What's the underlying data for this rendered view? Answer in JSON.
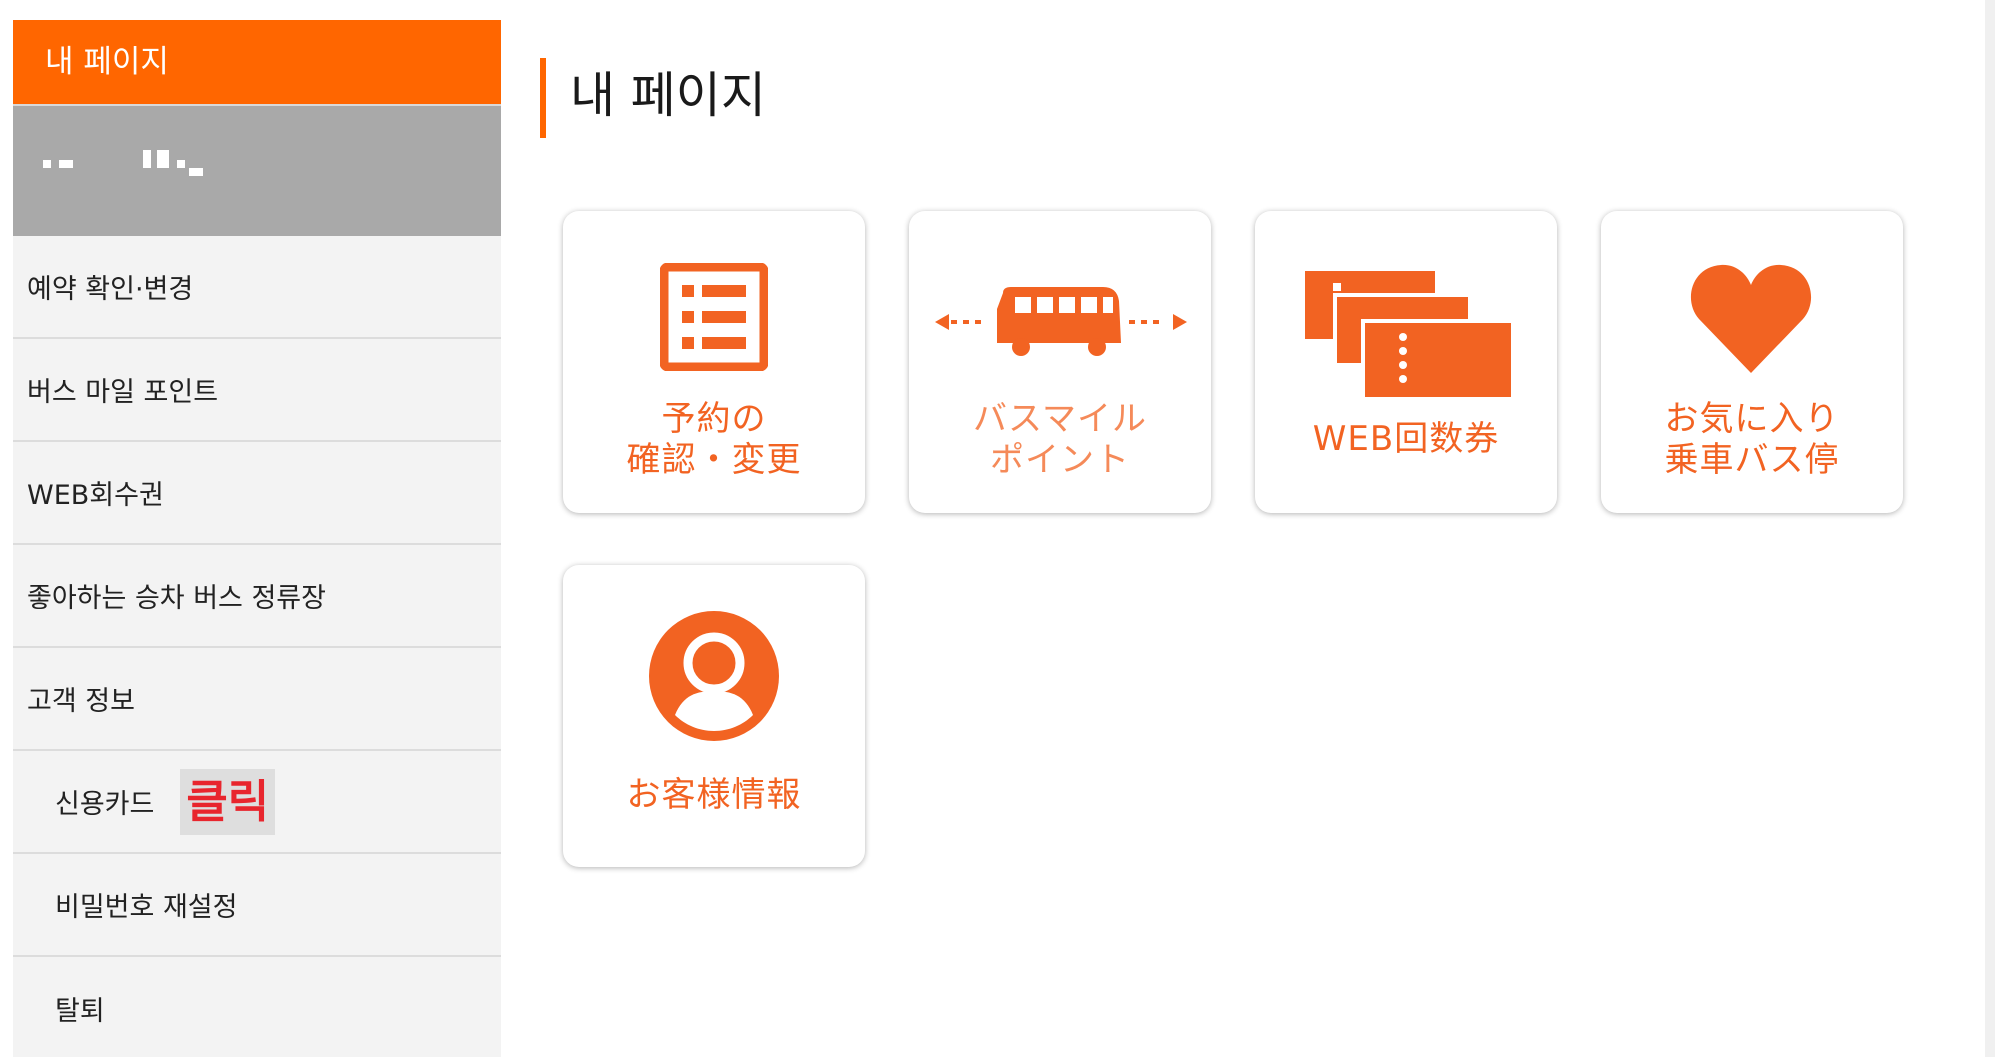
{
  "sidebar": {
    "header": "내 페이지",
    "items": [
      {
        "label": "예약 확인·변경"
      },
      {
        "label": "버스 마일 포인트"
      },
      {
        "label": "WEB회수권"
      },
      {
        "label": "좋아하는 승차 버스 정류장"
      },
      {
        "label": "고객 정보"
      },
      {
        "label": "신용카드",
        "annotation": "클릭"
      },
      {
        "label": "비밀번호 재설정"
      },
      {
        "label": "탈퇴"
      }
    ]
  },
  "main": {
    "title": "내 페이지",
    "tiles": [
      {
        "line1": "予約の",
        "line2": "確認・変更",
        "icon": "list-icon"
      },
      {
        "line1": "バスマイル",
        "line2": "ポイント",
        "icon": "bus-icon"
      },
      {
        "line1": "WEB回数券",
        "line2": "",
        "icon": "tickets-icon"
      },
      {
        "line1": "お気に入り",
        "line2": "乗車バス停",
        "icon": "heart-icon"
      },
      {
        "line1": "お客様情報",
        "line2": "",
        "icon": "user-icon"
      }
    ]
  },
  "colors": {
    "accent": "#ff6600",
    "tile_text": "#f26322",
    "annotation": "#e8252d"
  }
}
